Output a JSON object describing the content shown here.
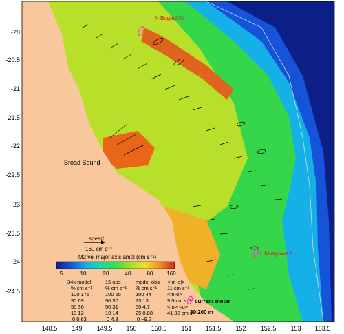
{
  "map": {
    "reef_labels": [
      "N Bugatti Rf",
      "L Musgrave I"
    ],
    "place_label": "Broad Sound",
    "x_ticks": [
      "148.5",
      "149",
      "149.5",
      "150",
      "150.5",
      "151",
      "151.5",
      "152",
      "152.5",
      "153",
      "153.5"
    ],
    "y_ticks": [
      "-20",
      "-20.5",
      "-21",
      "-21.5",
      "-22",
      "-22.5",
      "-23",
      "-23.5",
      "-24",
      "-24.5"
    ],
    "scale_arrow_title": "speed",
    "scale_arrow_value": "160 cm s⁻¹",
    "colorbar_title": "M2 vel major axis ampl (cm s⁻¹)",
    "colorbar_ticks": [
      "5",
      "10",
      "20",
      "40",
      "80",
      "160"
    ],
    "colorbar_ramp": [
      "#0a1f8f",
      "#1553d8",
      "#15b0e8",
      "#22d6a8",
      "#35e04a",
      "#9be12a",
      "#f1e024",
      "#f08a1f",
      "#c23517"
    ],
    "ocean_color": "#0b1f87",
    "land_color": "#f8c79b"
  },
  "stats_table": {
    "headers": [
      "34k model",
      "15 obs",
      "model-obs",
      "<|m-o|>"
    ],
    "subheaders": [
      "%  cm s⁻¹",
      "%  cm s⁻¹",
      "%  cm s⁻¹",
      "11 cm s⁻¹"
    ],
    "rows": [
      [
        "100 175",
        "100 55",
        "100 44",
        "<m-o>"
      ],
      [
        "90 69",
        "90 50",
        "75 13",
        "9.5 cm s⁻¹"
      ],
      [
        "50 36",
        "50 31",
        "50 4.7",
        "<m> <o>"
      ],
      [
        "10 12",
        "10 14",
        "25 0.88",
        "41 32 cm s⁻¹"
      ],
      [
        "0 0.63",
        "0 4.8",
        "0 −9.2",
        ""
      ]
    ]
  },
  "legend": {
    "current_meter_label": "current meter",
    "isobaths_label": "30  200 m"
  }
}
